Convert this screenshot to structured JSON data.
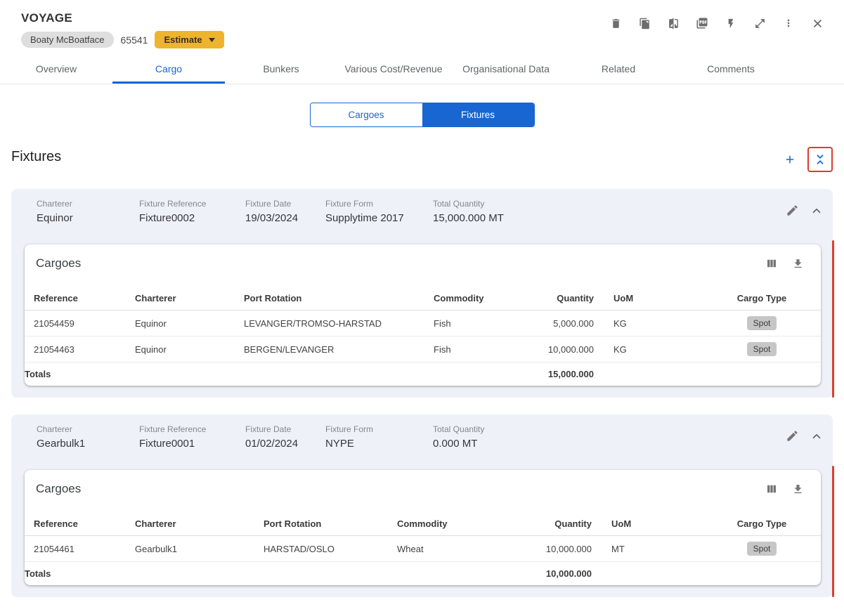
{
  "header": {
    "title": "VOYAGE",
    "vessel_name": "Boaty McBoatface",
    "voyage_number": "65541",
    "estimate_label": "Estimate",
    "toolbar_icons": [
      "delete-icon",
      "copy-icon",
      "compare-icon",
      "pdf-export-icon",
      "flash-icon",
      "expand-icon",
      "more-options-icon",
      "close-icon"
    ]
  },
  "tabs": [
    {
      "label": "Overview",
      "active": false
    },
    {
      "label": "Cargo",
      "active": true
    },
    {
      "label": "Bunkers",
      "active": false
    },
    {
      "label": "Various Cost/Revenue",
      "active": false
    },
    {
      "label": "Organisational Data",
      "active": false
    },
    {
      "label": "Related",
      "active": false
    },
    {
      "label": "Comments",
      "active": false
    }
  ],
  "view_toggle": [
    {
      "label": "Cargoes",
      "active": false
    },
    {
      "label": "Fixtures",
      "active": true
    }
  ],
  "fixtures_section": {
    "title": "Fixtures",
    "fixtures": [
      {
        "charterer": {
          "label": "Charterer",
          "value": "Equinor"
        },
        "fixture_reference": {
          "label": "Fixture Reference",
          "value": "Fixture0002"
        },
        "fixture_date": {
          "label": "Fixture Date",
          "value": "19/03/2024"
        },
        "fixture_form": {
          "label": "Fixture Form",
          "value": "Supplytime 2017"
        },
        "total_quantity": {
          "label": "Total Quantity",
          "value": "15,000.000 MT"
        },
        "cargoes": {
          "title": "Cargoes",
          "columns": [
            "Reference",
            "Charterer",
            "Port Rotation",
            "Commodity",
            "Quantity",
            "UoM",
            "Cargo Type"
          ],
          "rows": [
            {
              "reference": "21054459",
              "charterer": "Equinor",
              "port_rotation": "LEVANGER/TROMSO-HARSTAD",
              "commodity": "Fish",
              "quantity": "5,000.000",
              "uom": "KG",
              "cargo_type": "Spot"
            },
            {
              "reference": "21054463",
              "charterer": "Equinor",
              "port_rotation": "BERGEN/LEVANGER",
              "commodity": "Fish",
              "quantity": "10,000.000",
              "uom": "KG",
              "cargo_type": "Spot"
            }
          ],
          "totals_label": "Totals",
          "totals_quantity": "15,000.000"
        }
      },
      {
        "charterer": {
          "label": "Charterer",
          "value": "Gearbulk1"
        },
        "fixture_reference": {
          "label": "Fixture Reference",
          "value": "Fixture0001"
        },
        "fixture_date": {
          "label": "Fixture Date",
          "value": "01/02/2024"
        },
        "fixture_form": {
          "label": "Fixture Form",
          "value": "NYPE"
        },
        "total_quantity": {
          "label": "Total Quantity",
          "value": "0.000 MT"
        },
        "cargoes": {
          "title": "Cargoes",
          "columns": [
            "Reference",
            "Charterer",
            "Port Rotation",
            "Commodity",
            "Quantity",
            "UoM",
            "Cargo Type"
          ],
          "rows": [
            {
              "reference": "21054461",
              "charterer": "Gearbulk1",
              "port_rotation": "HARSTAD/OSLO",
              "commodity": "Wheat",
              "quantity": "10,000.000",
              "uom": "MT",
              "cargo_type": "Spot"
            }
          ],
          "totals_label": "Totals",
          "totals_quantity": "10,000.000"
        }
      }
    ]
  },
  "colors": {
    "accent_blue": "#1766d2",
    "estimate_amber": "#eeb42e",
    "alert_red": "#e23b2e",
    "badge_gray": "#c6c6c6",
    "fixture_card_bg": "#eef1f8"
  }
}
